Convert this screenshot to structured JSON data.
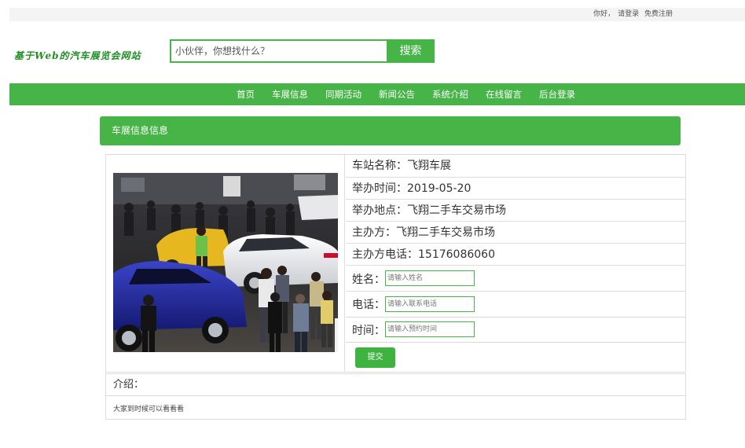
{
  "topbar": {
    "greeting": "你好，",
    "login": "请登录",
    "register": "免费注册"
  },
  "logo": {
    "text": "基于Web的汽车展览会网站"
  },
  "search": {
    "placeholder": "小伙伴，你想找什么？",
    "button": "搜索"
  },
  "nav": {
    "items": [
      "首页",
      "车展信息",
      "同期活动",
      "新闻公告",
      "系统介绍",
      "在线留言",
      "后台登录"
    ]
  },
  "section": {
    "title": "车展信息信息"
  },
  "detail": {
    "name": "车站名称：飞翔车展",
    "time": "举办时间：2019-05-20",
    "place": "举办地点：飞翔二手车交易市场",
    "organizer": "主办方：飞翔二手车交易市场",
    "phone": "主办方电话：15176086060"
  },
  "form": {
    "name_label": "姓名：",
    "name_placeholder": "请输入姓名",
    "phone_label": "电话：",
    "phone_placeholder": "请输入联系电话",
    "time_label": "时间：",
    "time_placeholder": "请输入预约时间",
    "submit": "提交"
  },
  "intro": {
    "label": "介绍：",
    "text": "大家到时候可以看看看"
  },
  "colors": {
    "accent": "#46b447",
    "border": "#dcdcdc"
  }
}
